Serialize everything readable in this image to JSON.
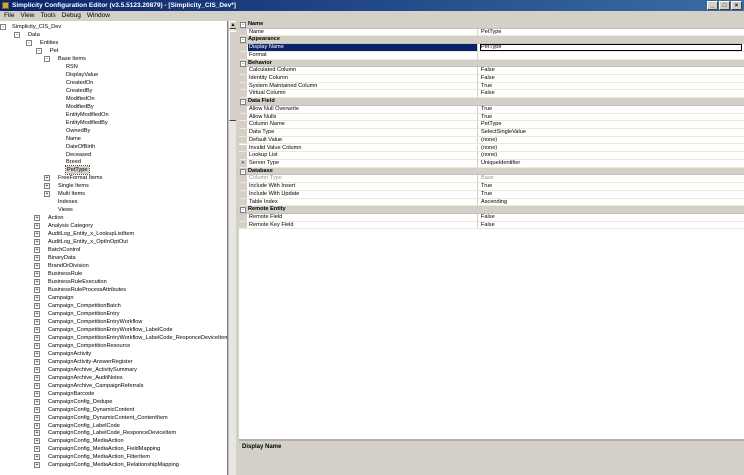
{
  "window": {
    "title": "Simplicity Configuration Editor (v3.5.5123.20879) - [Simplicity_CIS_Dev*]",
    "controls": [
      "_",
      "□",
      "×"
    ]
  },
  "menu": [
    "File",
    "View",
    "Tools",
    "Debug",
    "Window"
  ],
  "tree": {
    "nodes": [
      {
        "label": "Simplicity_CIS_Dev",
        "exp": "-"
      },
      {
        "label": "Data",
        "exp": "-"
      },
      {
        "label": "Entities",
        "exp": "-"
      },
      {
        "label": "Pet",
        "exp": "-"
      },
      {
        "label": "Base Items",
        "exp": "-"
      },
      {
        "label": "RSN"
      },
      {
        "label": "DisplayValue"
      },
      {
        "label": "CreatedOn"
      },
      {
        "label": "CreatedBy"
      },
      {
        "label": "ModifiedOn"
      },
      {
        "label": "ModifiedBy"
      },
      {
        "label": "EntityModifiedOn"
      },
      {
        "label": "EntityModifiedBy"
      },
      {
        "label": "OwnedBy"
      },
      {
        "label": "Name"
      },
      {
        "label": "DateOfBirth"
      },
      {
        "label": "Deceased"
      },
      {
        "label": "Breed"
      },
      {
        "label": "PetType",
        "selected": true
      },
      {
        "label": "FreeFormat Items",
        "exp": "+"
      },
      {
        "label": "Single Items",
        "exp": "+"
      },
      {
        "label": "Multi Items",
        "exp": "+"
      },
      {
        "label": "Indexes"
      },
      {
        "label": "Views"
      },
      {
        "label": "Action",
        "exp": "+"
      },
      {
        "label": "Analysis Category",
        "exp": "+"
      },
      {
        "label": "AuditLog_Entity_x_LookupListItem",
        "exp": "+"
      },
      {
        "label": "AuditLog_Entity_x_OptInOptOut",
        "exp": "+"
      },
      {
        "label": "BatchControl",
        "exp": "+"
      },
      {
        "label": "BinaryData",
        "exp": "+"
      },
      {
        "label": "BrandOrDivision",
        "exp": "+"
      },
      {
        "label": "BusinessRule",
        "exp": "+"
      },
      {
        "label": "BusinessRuleExecution",
        "exp": "+"
      },
      {
        "label": "BusinessRuleProcessAttributes",
        "exp": "+"
      },
      {
        "label": "Campaign",
        "exp": "+"
      },
      {
        "label": "Campaign_CompetitionBatch",
        "exp": "+"
      },
      {
        "label": "Campaign_CompetitionEntry",
        "exp": "+"
      },
      {
        "label": "Campaign_CompetitionEntryWorkflow",
        "exp": "+"
      },
      {
        "label": "Campaign_CompetitionEntryWorkflow_LabelCode",
        "exp": "+"
      },
      {
        "label": "Campaign_CompetitionEntryWorkflow_LabelCode_ResponceDeviceItem",
        "exp": "+"
      },
      {
        "label": "Campaign_CompetitionResource",
        "exp": "+"
      },
      {
        "label": "CampaignActivity",
        "exp": "+"
      },
      {
        "label": "CampaignActivity-AnswerRegister",
        "exp": "+"
      },
      {
        "label": "CampaignArchive_ActivitySummary",
        "exp": "+"
      },
      {
        "label": "CampaignArchive_AuditNotes",
        "exp": "+"
      },
      {
        "label": "CampaignArchive_CampaignReferrals",
        "exp": "+"
      },
      {
        "label": "CampaignBarcode",
        "exp": "+"
      },
      {
        "label": "CampaignConfig_Dedupe",
        "exp": "+"
      },
      {
        "label": "CampaignConfig_DynamicContent",
        "exp": "+"
      },
      {
        "label": "CampaignConfig_DynamicContent_ContentItem",
        "exp": "+"
      },
      {
        "label": "CampaignConfig_LabelCode",
        "exp": "+"
      },
      {
        "label": "CampaignConfig_LabelCode_ResponceDeviceItem",
        "exp": "+"
      },
      {
        "label": "CampaignConfig_MediaAction",
        "exp": "+"
      },
      {
        "label": "CampaignConfig_MediaAction_FieldMapping",
        "exp": "+"
      },
      {
        "label": "CampaignConfig_MediaAction_FilterItem",
        "exp": "+"
      },
      {
        "label": "CampaignConfig_MediaAction_RelationshipMapping",
        "exp": "+"
      }
    ]
  },
  "scrollbar": {
    "up": "▲"
  },
  "properties": {
    "rows": [
      {
        "type": "cat",
        "name": "Name",
        "exp": "-"
      },
      {
        "type": "prop",
        "name": "Name",
        "value": "PetType"
      },
      {
        "type": "cat",
        "name": "Appearance",
        "exp": "-"
      },
      {
        "type": "prop",
        "name": "Display Name",
        "value": "PetType",
        "selected": true
      },
      {
        "type": "prop",
        "name": "Format",
        "value": ""
      },
      {
        "type": "cat",
        "name": "Behavior",
        "exp": "-"
      },
      {
        "type": "prop",
        "name": "Calculated Column",
        "value": "False"
      },
      {
        "type": "prop",
        "name": "Identity Column",
        "value": "False"
      },
      {
        "type": "prop",
        "name": "System Maintained Column",
        "value": "True"
      },
      {
        "type": "prop",
        "name": "Virtual Column",
        "value": "False"
      },
      {
        "type": "cat",
        "name": "Data Field",
        "exp": "-"
      },
      {
        "type": "prop",
        "name": "Allow Null Overwrite",
        "value": "True"
      },
      {
        "type": "prop",
        "name": "Allow Nulls",
        "value": "True"
      },
      {
        "type": "prop",
        "name": "Column Name",
        "value": "PetType"
      },
      {
        "type": "prop",
        "name": "Data Type",
        "value": "SelectSingleValue"
      },
      {
        "type": "prop",
        "name": "Default Value",
        "value": "(none)"
      },
      {
        "type": "prop",
        "name": "Invalid Value Column",
        "value": "(none)"
      },
      {
        "type": "prop",
        "name": "Lookup List",
        "value": "(none)"
      },
      {
        "type": "prop",
        "name": "Server Type",
        "value": "UniqueIdentifier",
        "exp": "+"
      },
      {
        "type": "cat",
        "name": "Database",
        "exp": "-"
      },
      {
        "type": "prop",
        "name": "Column Type",
        "value": "Base",
        "disabled": true
      },
      {
        "type": "prop",
        "name": "Include With Insert",
        "value": "True"
      },
      {
        "type": "prop",
        "name": "Include With Update",
        "value": "True"
      },
      {
        "type": "prop",
        "name": "Table Index",
        "value": "Ascending"
      },
      {
        "type": "cat",
        "name": "Remote Entity",
        "exp": "-"
      },
      {
        "type": "prop",
        "name": "Remote Field",
        "value": "False"
      },
      {
        "type": "prop",
        "name": "Remote Key Field",
        "value": "False"
      }
    ]
  },
  "description": {
    "title": "Display Name"
  }
}
